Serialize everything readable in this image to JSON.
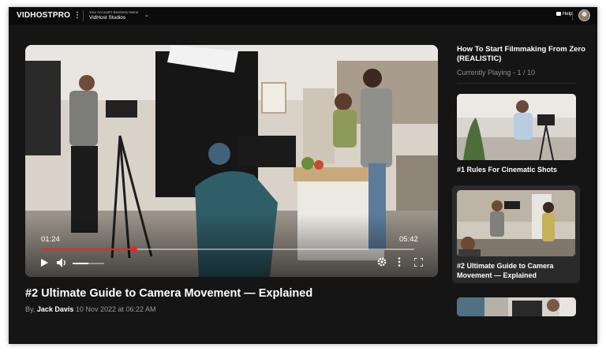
{
  "topbar": {
    "brand": "VIDHOSTPRO",
    "account_label": "Your Account's Business Name",
    "account_name": "VidHost Studios",
    "help_label": "Help"
  },
  "player": {
    "current_time": "01:24",
    "duration": "05:42",
    "progress": 0.25,
    "volume": 0.5
  },
  "video": {
    "title": "#2 Ultimate Guide to Camera Movement —  Explained",
    "by_prefix": "By,",
    "author": "Jack Davis",
    "date": "10 Nov 2022 at 06:22 AM"
  },
  "playlist": {
    "title": "How To Start Filmmaking From Zero (REALISTIC)",
    "status": "Currently Playing - 1 / 10",
    "items": [
      {
        "label": "#1 Rules For Cinematic Shots",
        "active": false
      },
      {
        "label": "#2 Ultimate Guide to Camera Movement —  Explained",
        "active": true
      },
      {
        "label": "",
        "active": false
      }
    ]
  },
  "colors": {
    "accent": "#e8262c",
    "background": "#151515",
    "topbar": "#0b0b0b"
  }
}
